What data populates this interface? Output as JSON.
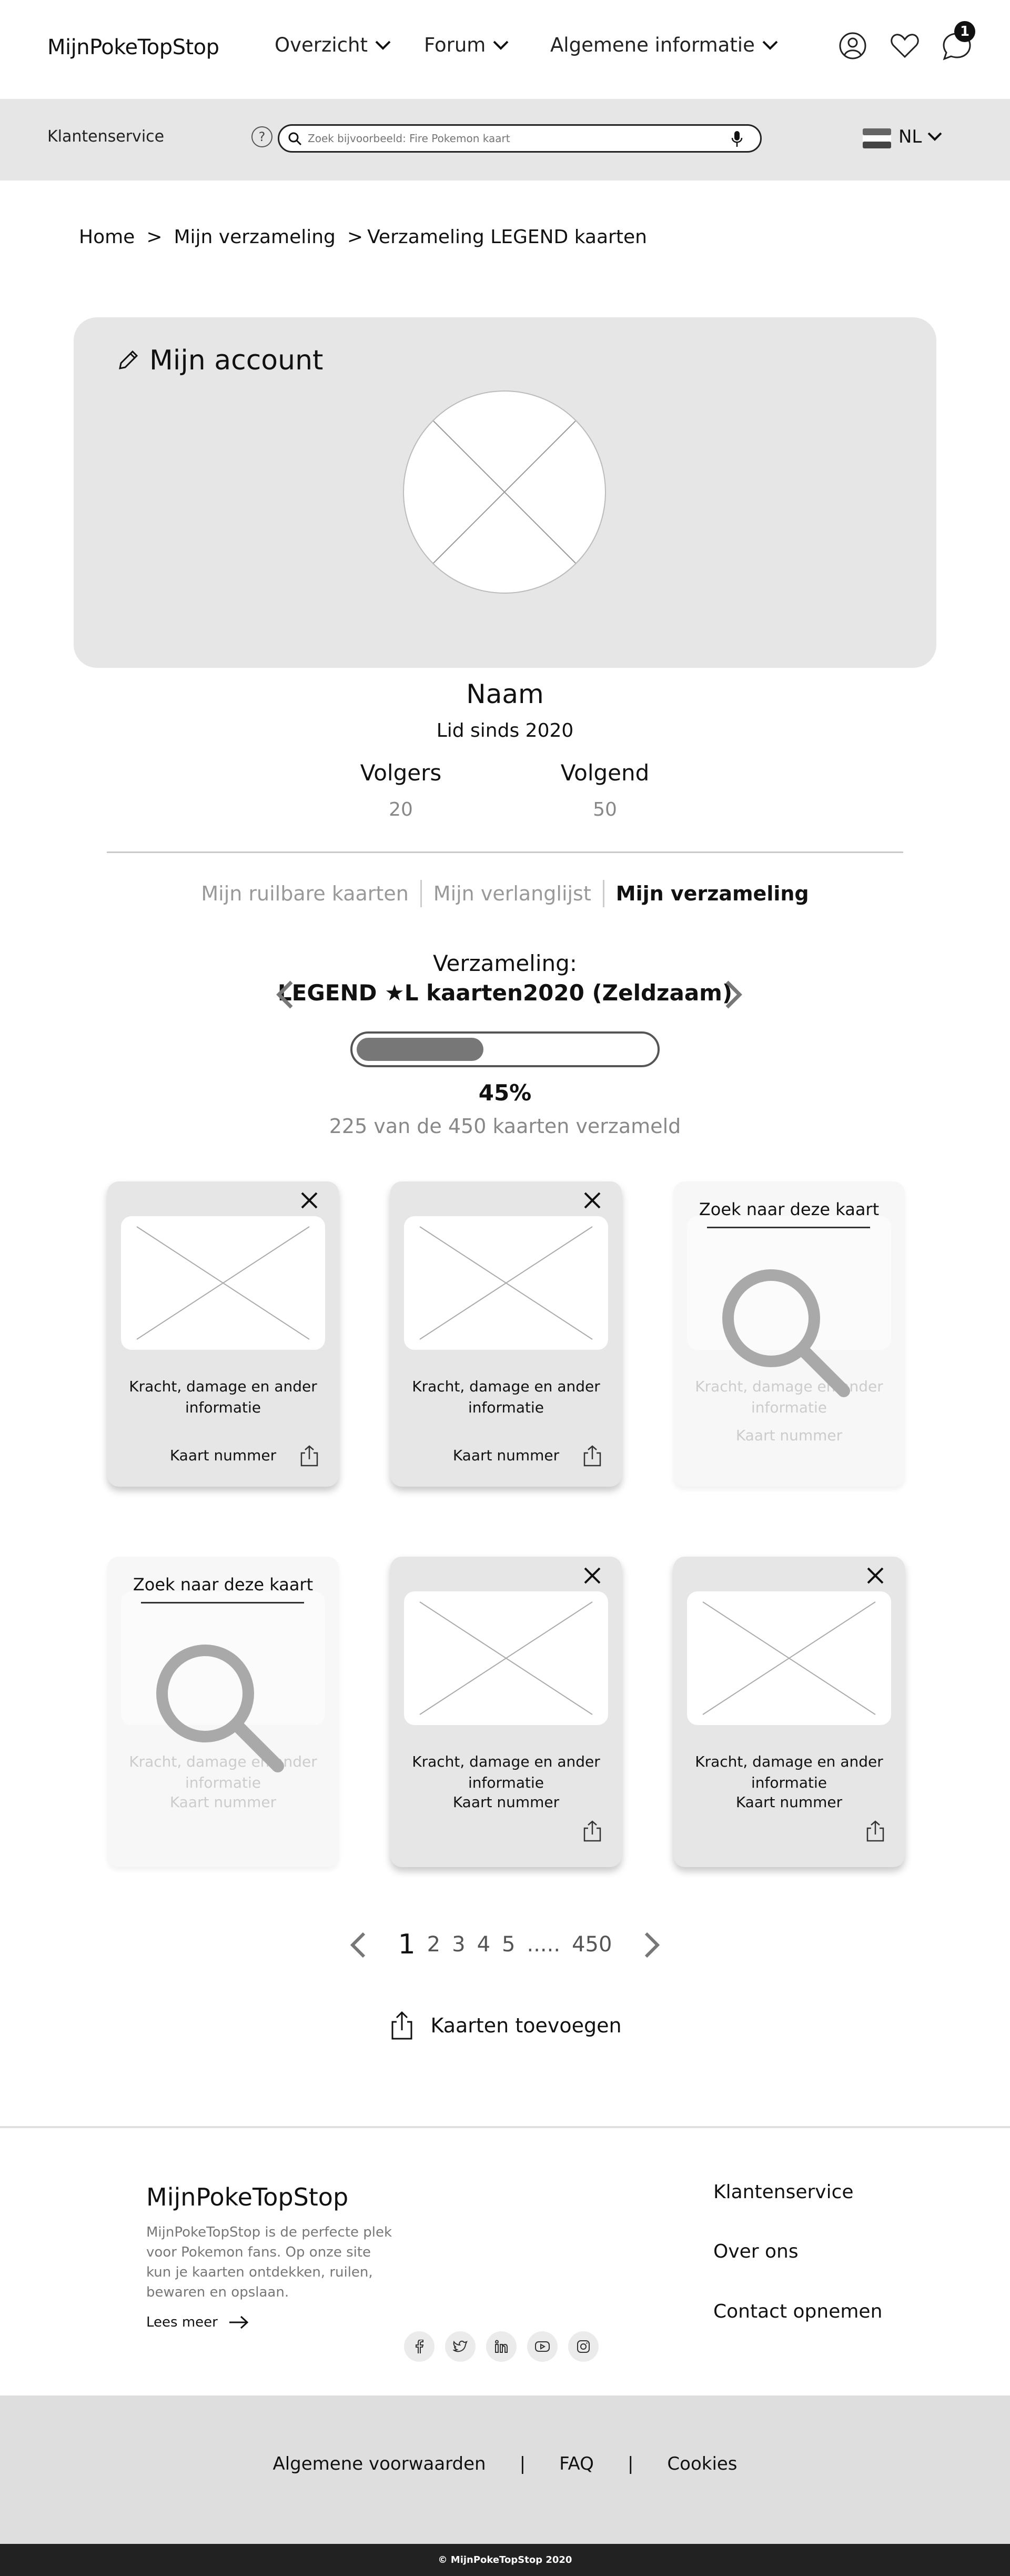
{
  "header": {
    "logo": "MijnPokeTopStop",
    "nav": [
      {
        "label": "Overzicht"
      },
      {
        "label": "Forum"
      },
      {
        "label": "Algemene informatie"
      }
    ],
    "icons": [
      "user-icon",
      "heart-icon",
      "chat-icon"
    ],
    "notification_count": "1"
  },
  "subbar": {
    "customer_service": "Klantenservice",
    "help": "?",
    "search_placeholder": "Zoek bijvoorbeeld: Fire Pokemon kaart",
    "language": "NL"
  },
  "breadcrumb": {
    "home": "Home",
    "collection": "Mijn verzameling",
    "current": "Verzameling LEGEND kaarten",
    "separator": ">"
  },
  "account": {
    "title": "Mijn account",
    "name": "Naam",
    "member_since": "Lid sinds 2020",
    "followers_label": "Volgers",
    "followers_value": "20",
    "following_label": "Volgend",
    "following_value": "50"
  },
  "tabs": [
    {
      "label": "Mijn ruilbare kaarten",
      "active": false
    },
    {
      "label": "Mijn verlanglijst",
      "active": false
    },
    {
      "label": "Mijn verzameling",
      "active": true
    }
  ],
  "collection": {
    "label": "Verzameling:",
    "name": "LEGEND ★L kaarten2020 (Zeldzaam)",
    "progress": 0.45,
    "percent": "45%",
    "count_text": "225 van de 450 kaarten verzameld"
  },
  "cards": [
    {
      "type": "owned",
      "info": "Kracht, damage en ander informatie",
      "number": "Kaart nummer"
    },
    {
      "type": "owned",
      "info": "Kracht, damage en ander informatie",
      "number": "Kaart nummer"
    },
    {
      "type": "missing",
      "find": "Zoek naar deze kaart",
      "info": "Kracht, damage en ander informatie",
      "number": "Kaart nummer"
    },
    {
      "type": "missing",
      "find": "Zoek naar deze kaart",
      "info": "Kracht, damage en ander informatie",
      "number": "Kaart nummer"
    },
    {
      "type": "owned",
      "info": "Kracht, damage en ander informatie",
      "number": "Kaart nummer"
    },
    {
      "type": "owned",
      "info": "Kracht, damage en ander informatie",
      "number": "Kaart nummer"
    }
  ],
  "pagination": {
    "current": "1",
    "pages": [
      "2",
      "3",
      "4",
      "5"
    ],
    "ellipsis": ".....",
    "last": "450"
  },
  "add_cards": "Kaarten toevoegen",
  "footer": {
    "brand": "MijnPokeTopStop",
    "description": "MijnPokeTopStop is de perfecte plek voor Pokemon fans. Op onze site kun je kaarten ontdekken, ruilen, bewaren en opslaan.",
    "read_more": "Lees meer",
    "links": [
      "Klantenservice",
      "Over ons",
      "Contact opnemen"
    ],
    "social": [
      "facebook-icon",
      "twitter-icon",
      "linkedin-icon",
      "youtube-icon",
      "instagram-icon"
    ],
    "legal": [
      "Algemene voorwaarden",
      "FAQ",
      "Cookies"
    ],
    "legal_separator": "|",
    "copyright": "© MijnPokeTopStop 2020"
  }
}
